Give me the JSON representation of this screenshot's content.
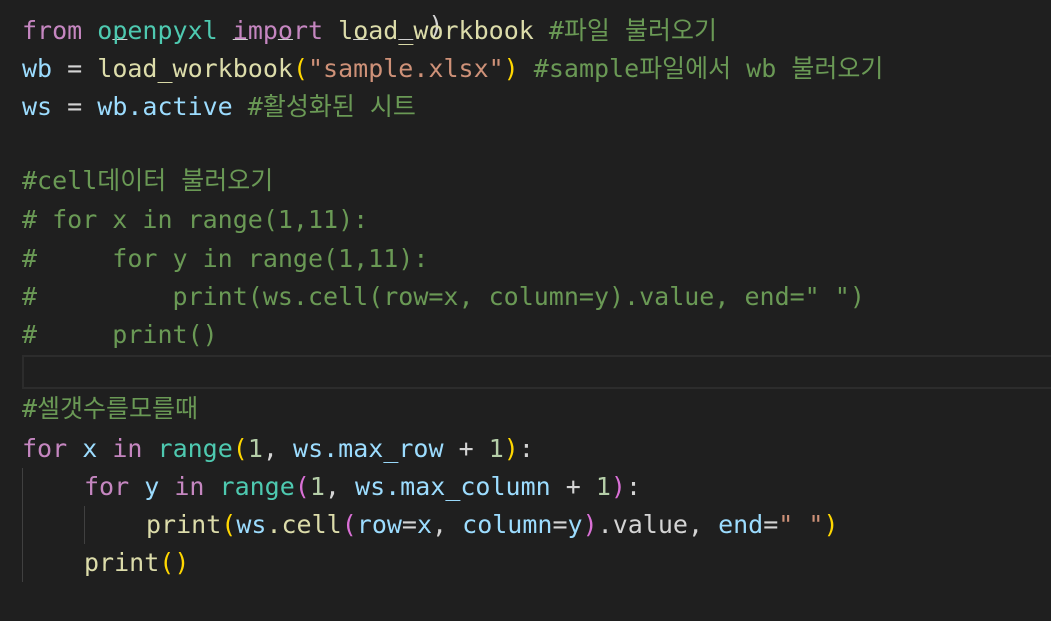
{
  "editor": {
    "line0_partial": "  _       _  _    _  _ )",
    "line1": {
      "kw_from": "from",
      "module": "openpyxl",
      "kw_import": "import",
      "name": "load_workbook",
      "comment": "#파일 불러오기"
    },
    "line2": {
      "var": "wb",
      "eq": " = ",
      "fn": "load_workbook",
      "str": "\"sample.xlsx\"",
      "comment": "#sample파일에서 wb 불러오기"
    },
    "line3": {
      "var": "ws",
      "eq": " = ",
      "obj": "wb",
      "attr": ".active",
      "comment": "#활성화된 시트"
    },
    "line5": "#cell데이터 불러오기",
    "line6": "# for x in range(1,11):",
    "line7": "#     for y in range(1,11):",
    "line8": "#         print(ws.cell(row=x, column=y).value, end=\" \")",
    "line9": "#     print()",
    "line11": "#셀갯수를모를때",
    "line12": {
      "kw_for": "for",
      "var": "x",
      "kw_in": "in",
      "fn": "range",
      "one": "1",
      "obj": "ws",
      "attr": ".max_row",
      "plus": " + ",
      "one2": "1"
    },
    "line13": {
      "kw_for": "for",
      "var": "y",
      "kw_in": "in",
      "fn": "range",
      "one": "1",
      "obj": "ws",
      "attr": ".max_column",
      "plus": " + ",
      "one2": "1"
    },
    "line14": {
      "fn": "print",
      "obj": "ws",
      "method": ".cell",
      "row_kw": "row",
      "row_val": "x",
      "col_kw": "column",
      "col_val": "y",
      "value_attr": ".value, ",
      "end_kw": "end",
      "end_str": "\" \""
    },
    "line15": {
      "fn": "print"
    }
  }
}
